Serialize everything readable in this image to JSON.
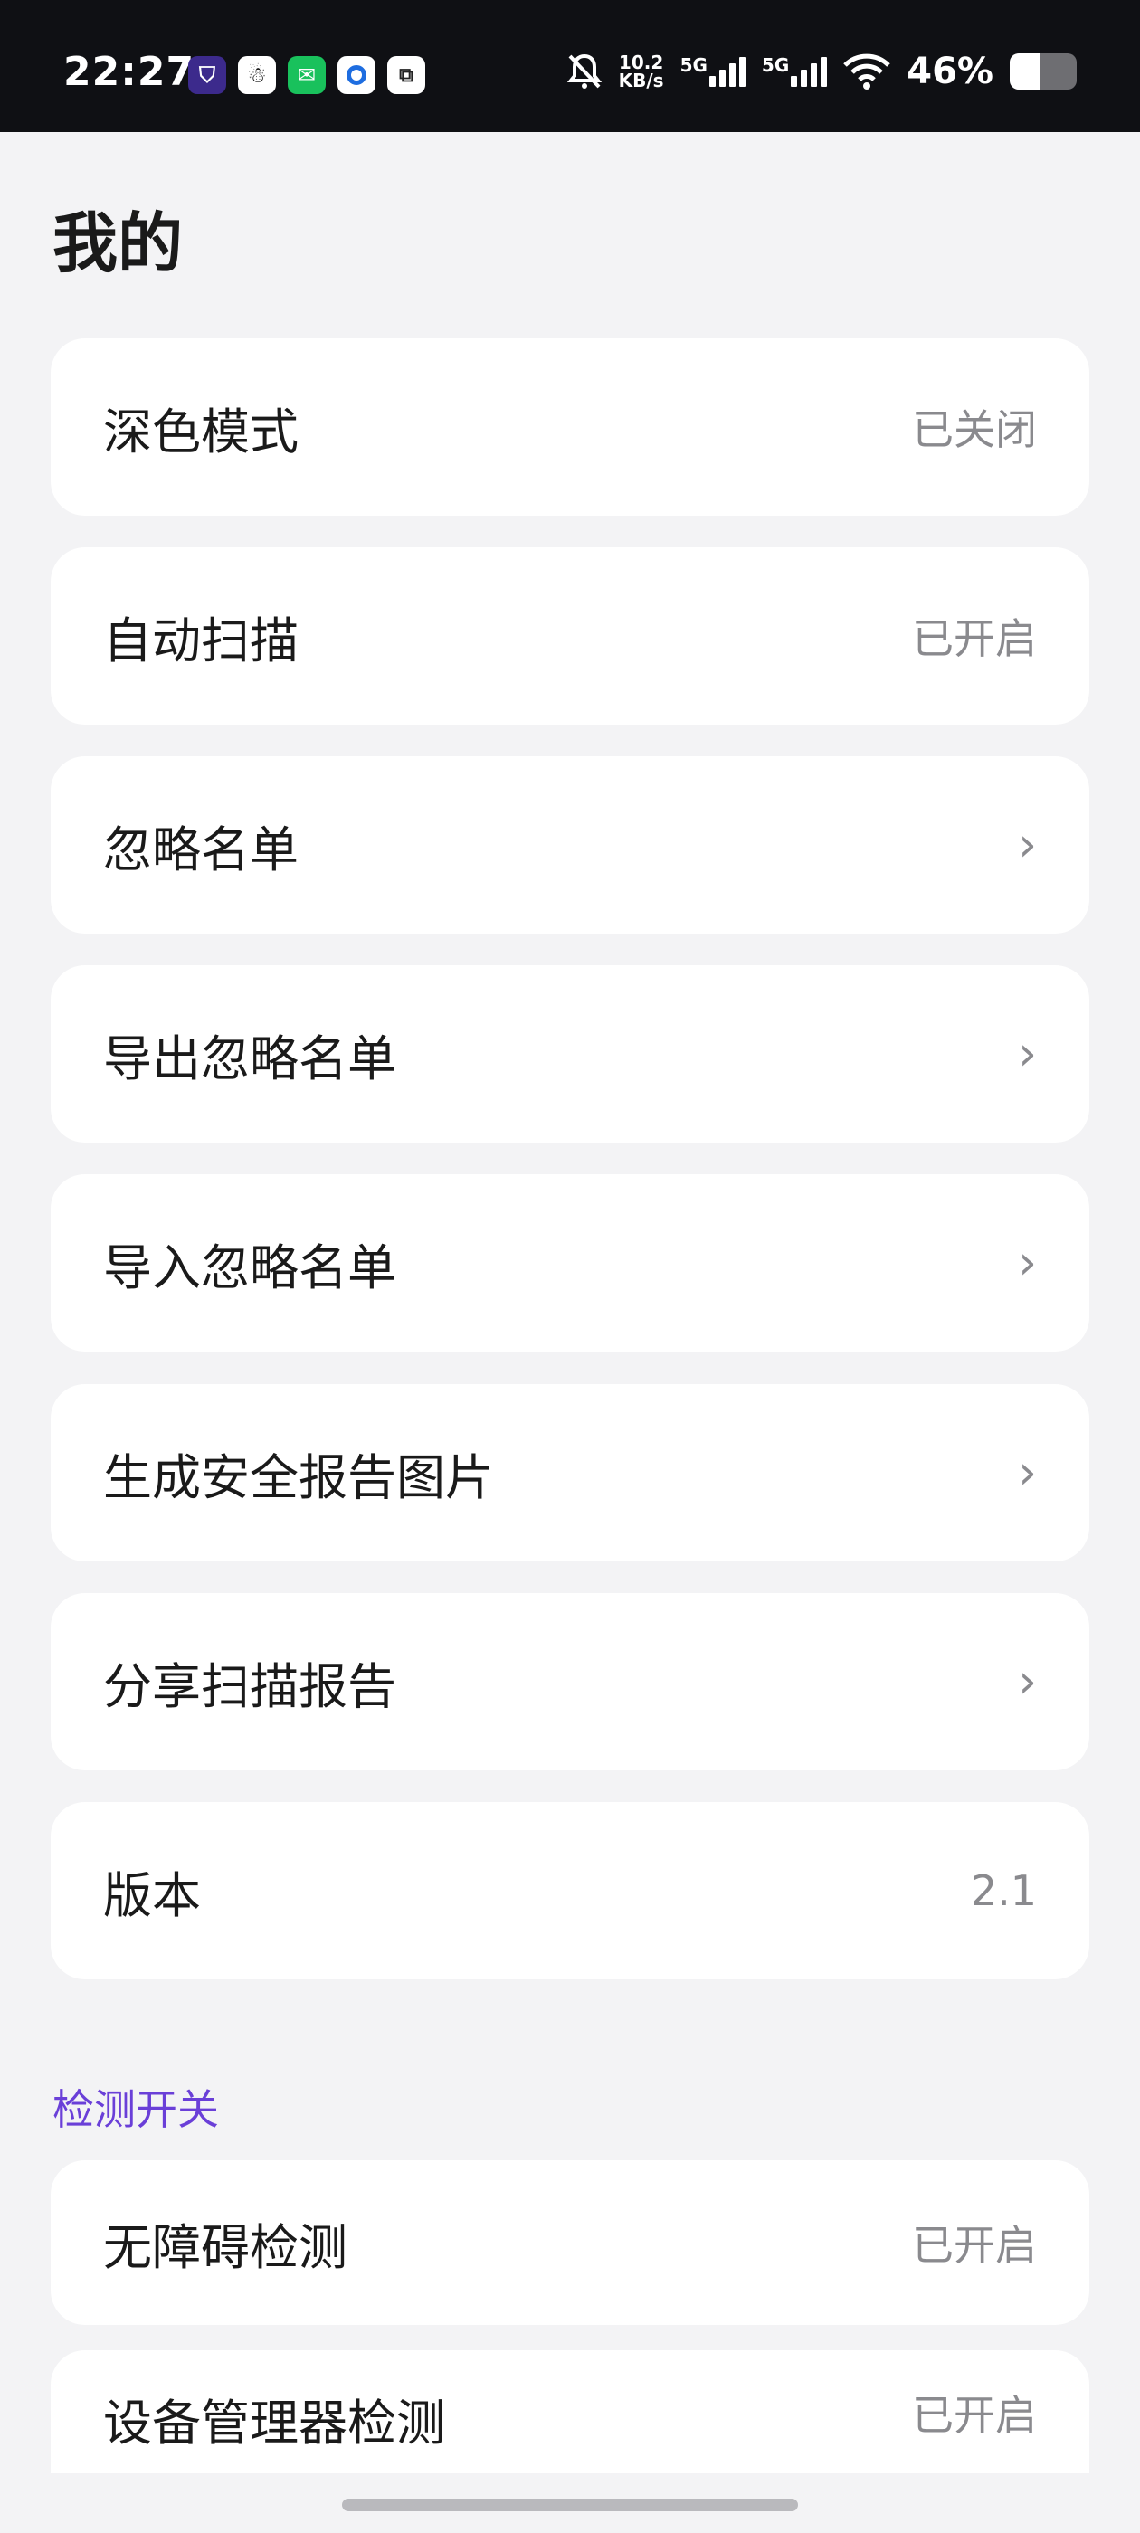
{
  "status_bar": {
    "time": "22:27",
    "net_speed_value": "10.2",
    "net_speed_unit": "KB/s",
    "sim1": "5G",
    "sim2": "5G",
    "battery_percent": "46%",
    "battery_level": 0.46,
    "icons": [
      "shield-app-icon",
      "qq-icon",
      "wechat-icon",
      "circle-app-icon",
      "link-app-icon",
      "bell-muted-icon",
      "signal-icon",
      "wifi-icon",
      "battery-icon"
    ]
  },
  "page": {
    "title": "我的"
  },
  "settings": [
    {
      "label": "深色模式",
      "value": "已关闭"
    },
    {
      "label": "自动扫描",
      "value": "已开启"
    },
    {
      "label": "忽略名单",
      "chevron": "›"
    },
    {
      "label": "导出忽略名单",
      "chevron": "›"
    },
    {
      "label": "导入忽略名单",
      "chevron": "›"
    },
    {
      "label": "生成安全报告图片",
      "chevron": "›"
    },
    {
      "label": "分享扫描报告",
      "chevron": "›"
    },
    {
      "label": "版本",
      "value": "2.1"
    }
  ],
  "detection": {
    "header": "检测开关",
    "items": [
      {
        "label": "无障碍检测",
        "value": "已开启"
      },
      {
        "label": "设备管理器检测",
        "value": "已开启"
      }
    ]
  },
  "colors": {
    "accent": "#6a3fd8",
    "status_bar_bg": "#0f1014",
    "page_bg": "#f3f3f5"
  }
}
